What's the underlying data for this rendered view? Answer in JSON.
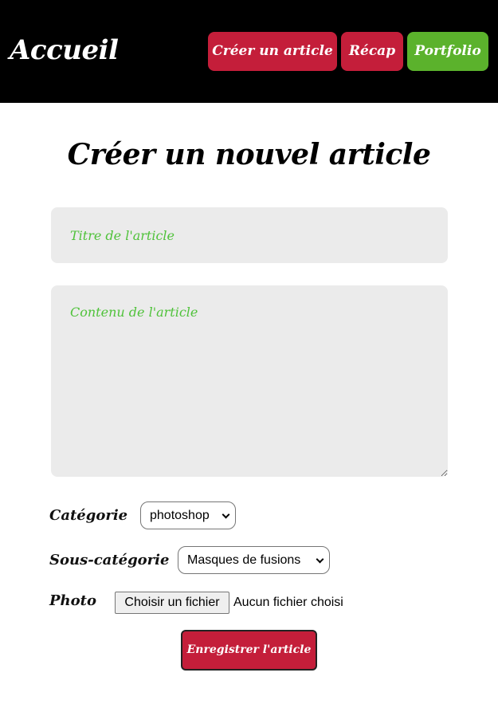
{
  "colors": {
    "header_bg": "#000000",
    "primary": "#c41e3a",
    "accent": "#5bb22c",
    "field_bg": "#ebebeb",
    "placeholder": "#4fc23a"
  },
  "header": {
    "logo": "Accueil",
    "nav": {
      "create_label": "Créer un article",
      "recap_label": "Récap",
      "portfolio_label": "Portfolio"
    }
  },
  "form": {
    "page_title": "Créer un nouvel article",
    "title_placeholder": "Titre de l'article",
    "content_placeholder": "Contenu de l'article",
    "category_label": "Catégorie",
    "category_value": "photoshop",
    "subcategory_label": "Sous-catégorie",
    "subcategory_value": "Masques de fusions",
    "photo_label": "Photo",
    "file_button_label": "Choisir un fichier",
    "file_status": "Aucun fichier choisi",
    "submit_label": "Enregistrer l'article"
  }
}
